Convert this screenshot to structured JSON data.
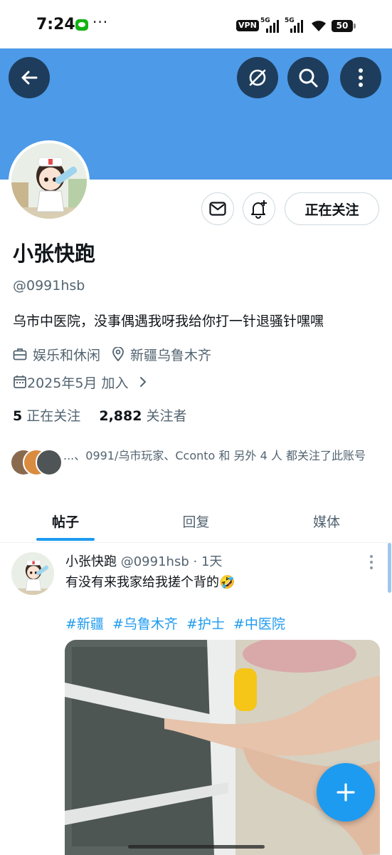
{
  "status_bar": {
    "time": "7:24",
    "dots": "···",
    "vpn": "VPN",
    "network1": "5G",
    "network2": "5G",
    "battery": "50"
  },
  "header": {
    "back_icon": "arrow-left-icon",
    "grok_icon": "grok-icon",
    "search_icon": "search-icon",
    "more_icon": "more-vertical-icon",
    "banner_color": "#4d9ae8"
  },
  "profile": {
    "display_name": "小张快跑",
    "handle": "@0991hsb",
    "bio": "乌市中医院，没事偶遇我呀我给你打一针退骚针嘿嘿",
    "category": "娱乐和休闲",
    "location": "新疆乌鲁木齐",
    "joined": "2025年5月 加入",
    "following_count": "5",
    "following_label": "正在关注",
    "followers_count": "2,882",
    "followers_label": "关注者",
    "follow_button": "正在关注",
    "followers_you_know": "...、0991/乌市玩家、Cconto 和 另外 4 人 都关注了此账号"
  },
  "tabs": [
    {
      "label": "帖子",
      "active": true
    },
    {
      "label": "回复",
      "active": false
    },
    {
      "label": "媒体",
      "active": false
    }
  ],
  "post": {
    "author": "小张快跑",
    "handle": "@0991hsb",
    "time": "· 1天",
    "text": "有没有来我家给我搓个背的🤣",
    "hashtags": [
      "#新疆",
      "#乌鲁木齐",
      "#护士",
      "#中医院"
    ]
  },
  "fab": {
    "icon": "plus-icon"
  },
  "colors": {
    "accent": "#1d9bf0",
    "header_button": "#1e3d5c"
  }
}
